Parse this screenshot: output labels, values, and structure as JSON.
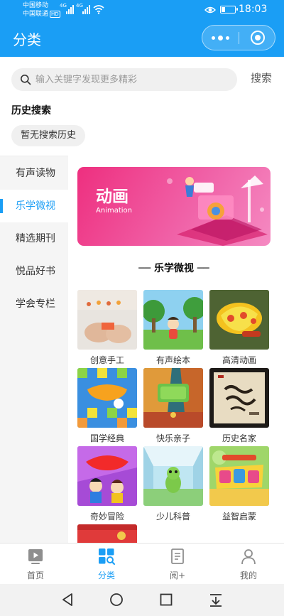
{
  "status_bar": {
    "carrier1": "中国移动",
    "carrier2": "中国联通",
    "hd_badge": "HD",
    "network1": "4G",
    "network2": "4G",
    "time": "18:03",
    "battery_level_fraction": 0.25,
    "icons": [
      "signal-icon",
      "wifi-icon",
      "eye-icon",
      "battery-icon"
    ]
  },
  "header": {
    "title": "分类",
    "capsule_icons": [
      "more-dots-icon",
      "close-target-icon"
    ]
  },
  "search": {
    "placeholder": "输入关键字发现更多精彩",
    "button_label": "搜索"
  },
  "history": {
    "title": "历史搜索",
    "empty_chip": "暂无搜索历史"
  },
  "sidebar": {
    "items": [
      {
        "label": "有声读物",
        "active": false
      },
      {
        "label": "乐学微视",
        "active": true
      },
      {
        "label": "精选期刊",
        "active": false
      },
      {
        "label": "悦品好书",
        "active": false
      },
      {
        "label": "学会专栏",
        "active": false
      }
    ]
  },
  "banner": {
    "title": "动画",
    "subtitle": "Animation",
    "colors": {
      "start": "#ee2f7f",
      "end": "#f58ac2"
    }
  },
  "section": {
    "title": "── 乐学微视 ──"
  },
  "tiles": [
    {
      "label": "创意手工"
    },
    {
      "label": "有声绘本"
    },
    {
      "label": "高清动画"
    },
    {
      "label": "国学经典"
    },
    {
      "label": "快乐亲子"
    },
    {
      "label": "历史名家"
    },
    {
      "label": "奇妙冒险"
    },
    {
      "label": "少儿科普"
    },
    {
      "label": "益智启蒙"
    }
  ],
  "tabbar": {
    "items": [
      {
        "label": "首页",
        "icon": "play-home-icon",
        "active": false
      },
      {
        "label": "分类",
        "icon": "category-grid-icon",
        "active": true
      },
      {
        "label": "阅+",
        "icon": "book-read-icon",
        "active": false
      },
      {
        "label": "我的",
        "icon": "user-profile-icon",
        "active": false
      }
    ]
  },
  "colors": {
    "accent": "#1a9ef5",
    "sidebar_bg": "#f5f5f5",
    "text": "#333333"
  }
}
